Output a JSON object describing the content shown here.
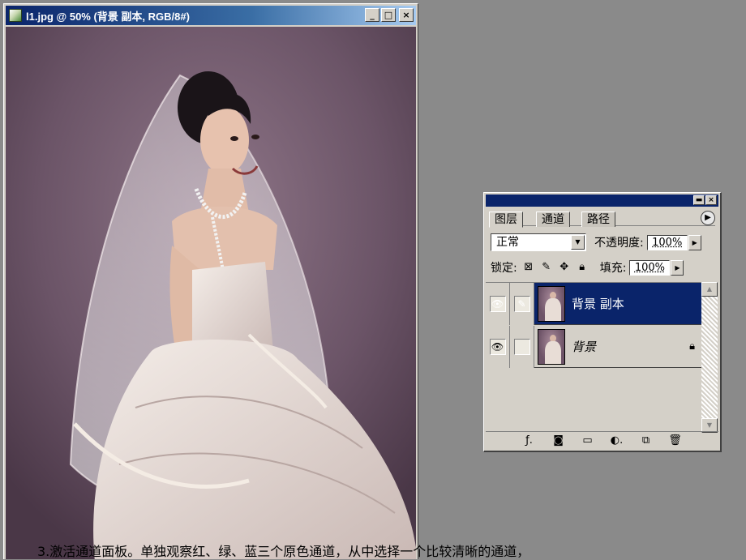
{
  "document_window": {
    "title": "l1.jpg @ 50% (背景 副本, RGB/8#)",
    "buttons": {
      "minimize": "_",
      "maximize": "□",
      "close": "×"
    }
  },
  "layers_palette": {
    "tabs": [
      {
        "label": "图层"
      },
      {
        "label": "通道"
      },
      {
        "label": "路径"
      }
    ],
    "blend_mode": "正常",
    "opacity_label": "不透明度:",
    "opacity_value": "100%",
    "lock_label": "锁定:",
    "fill_label": "填充:",
    "fill_value": "100%",
    "layers": [
      {
        "name": "背景 副本"
      },
      {
        "name": "背景"
      }
    ]
  },
  "caption": "3.激活通道面板。单独观察红、绿、蓝三个原色通道，从中选择一个比较清晰的通道，"
}
